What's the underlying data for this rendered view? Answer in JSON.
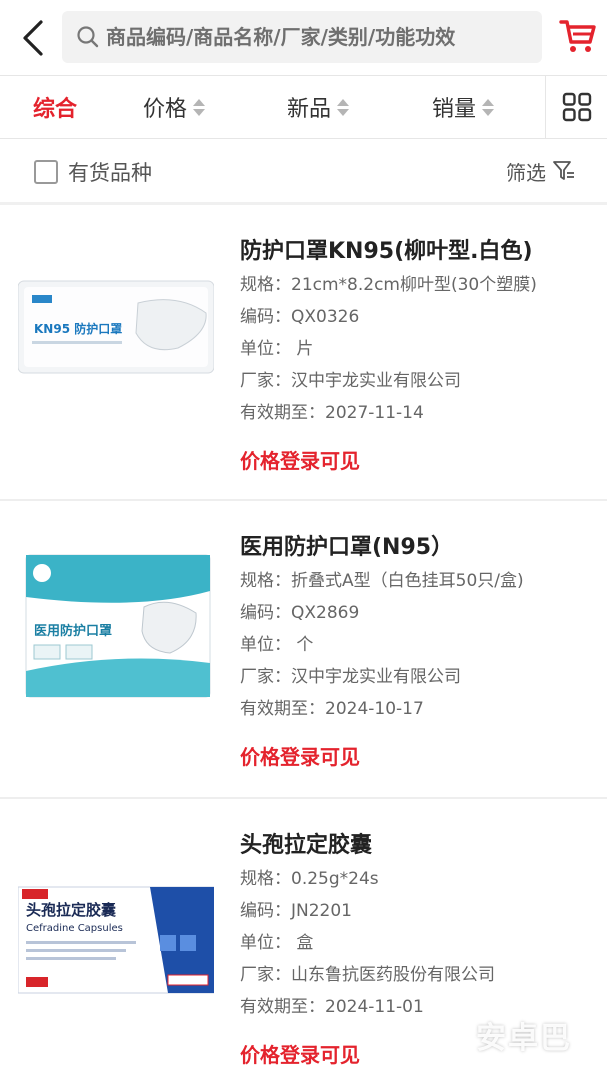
{
  "header": {
    "search_placeholder": "商品编码/商品名称/厂家/类别/功能功效"
  },
  "sort": {
    "items": [
      {
        "label": "综合",
        "active": true
      },
      {
        "label": "价格",
        "active": false
      },
      {
        "label": "新品",
        "active": false
      },
      {
        "label": "销量",
        "active": false
      }
    ]
  },
  "filter": {
    "stock_label": "有货品种",
    "filter_label": "筛选"
  },
  "products": [
    {
      "title": "防护口罩KN95(柳叶型.白色)",
      "spec": "规格：21cm*8.2cm柳叶型(30个塑膜)",
      "code": "编码：QX0326",
      "unit": "单位：  片",
      "maker": "厂家：汉中宇龙实业有限公司",
      "expiry": "有效期至：2027-11-14",
      "price": "价格登录可见",
      "image_text": "KN95 防护口罩"
    },
    {
      "title": "医用防护口罩(N95）",
      "spec": "规格：折叠式A型（白色挂耳50只/盒)",
      "code": "编码：QX2869",
      "unit": "单位：  个",
      "maker": "厂家：汉中宇龙实业有限公司",
      "expiry": "有效期至：2024-10-17",
      "price": "价格登录可见",
      "image_text": "医用防护口罩"
    },
    {
      "title": "头孢拉定胶囊",
      "spec": "规格：0.25g*24s",
      "code": "编码：JN2201",
      "unit": "单位：  盒",
      "maker": "厂家：山东鲁抗医药股份有限公司",
      "expiry": "有效期至：2024-11-01",
      "price": "价格登录可见",
      "image_text": "头孢拉定胶囊",
      "image_subtext": "Cefradine Capsules"
    }
  ],
  "watermark": "安卓巴",
  "colors": {
    "accent": "#e4232d",
    "text": "#222222",
    "muted": "#666666"
  }
}
